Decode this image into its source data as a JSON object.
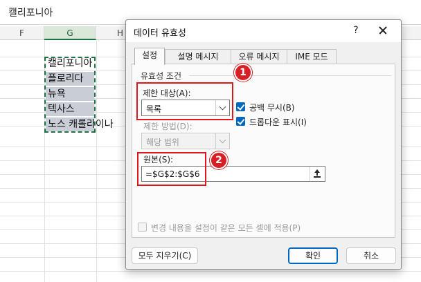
{
  "formula_bar": {
    "value": "캘리포니아"
  },
  "columns": [
    "F",
    "G",
    "H"
  ],
  "cells": [
    "캘리포니아",
    "플로리다",
    "뉴욕",
    "텍사스",
    "노스 캐롤라이나"
  ],
  "dialog": {
    "title": "데이터 유효성",
    "help_label": "?",
    "tabs": [
      "설정",
      "설명 메시지",
      "오류 메시지",
      "IME 모드"
    ],
    "active_tab": "설정",
    "group_label": "유효성 조건",
    "allow_label": "제한 대상(A):",
    "allow_value": "목록",
    "ignore_blank_label": "공백 무시(B)",
    "ignore_blank_checked": true,
    "dropdown_label": "드롭다운 표시(I)",
    "dropdown_checked": true,
    "data_label": "제한 방법(D):",
    "data_value": "해당 범위",
    "source_label": "원본(S):",
    "source_value": "=$G$2:$G$6",
    "apply_all_label": "변경 내용을 설정이 같은 모든 셀에 적용(P)",
    "apply_all_checked": false,
    "clear_all_label": "모두 지우기(C)",
    "ok_label": "확인",
    "cancel_label": "취소"
  },
  "callouts": [
    "1",
    "2"
  ],
  "colors": {
    "highlight": "#e0161e",
    "accent": "#0067c0",
    "selection": "#1e7145"
  }
}
